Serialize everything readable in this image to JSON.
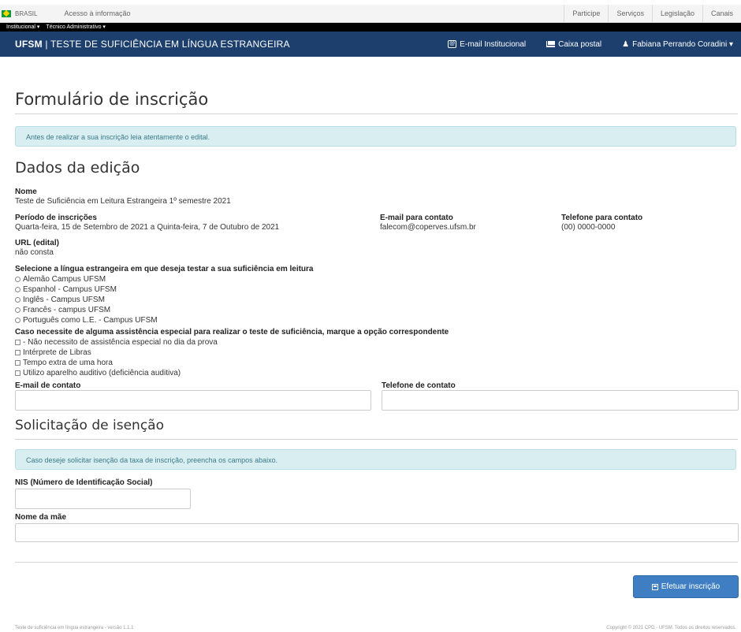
{
  "gov_bar": {
    "brasil": "BRASIL",
    "acesso": "Acesso à informação",
    "links": [
      "Participe",
      "Serviços",
      "Legislação",
      "Canais"
    ]
  },
  "sub_bar": {
    "items": [
      "Institucional ▾",
      "Técnico Administrativo ▾"
    ]
  },
  "navbar": {
    "brand_bold": "UFSM",
    "brand_rest": " | TESTE DE SUFICIÊNCIA EM LÍNGUA ESTRANGEIRA",
    "email_inst": "E-mail Institucional",
    "caixa_postal": "Caixa postal",
    "user": "Fabiana Perrando Coradini ▾"
  },
  "page_title": "Formulário de inscrição",
  "alert_edital": "Antes de realizar a sua inscrição leia atentamente o edital.",
  "dados": {
    "title": "Dados da edição",
    "nome_label": "Nome",
    "nome_value": "Teste de Suficiência em Leitura Estrangeira 1º semestre 2021",
    "periodo_label": "Período de inscrições",
    "periodo_value": "Quarta-feira, 15 de Setembro de 2021 a Quinta-feira, 7 de Outubro de 2021",
    "email_label": "E-mail para contato",
    "email_value": "falecom@coperves.ufsm.br",
    "telefone_label": "Telefone para contato",
    "telefone_value": "(00) 0000-0000",
    "url_label": "URL (edital)",
    "url_value": "não consta"
  },
  "lingua": {
    "label": "Selecione a língua estrangeira em que deseja testar a sua suficiência em leitura",
    "options": [
      "Alemão Campus UFSM",
      "Espanhol - Campus UFSM",
      "Inglês - Campus UFSM",
      "Francês - campus UFSM",
      "Português como L.E. - Campus UFSM"
    ]
  },
  "assistencia": {
    "label": "Caso necessite de alguma assistência especial para realizar o teste de suficiência, marque a opção correspondente",
    "options": [
      "- Não necessito de assistência especial no dia da prova",
      "Intérprete de Libras",
      "Tempo extra de uma hora",
      "Utilizo aparelho auditivo (deficiência auditiva)"
    ]
  },
  "contato": {
    "email_label": "E-mail de contato",
    "telefone_label": "Telefone de contato"
  },
  "isencao": {
    "title": "Solicitação de isenção",
    "alert": "Caso deseje solicitar isenção da taxa de inscrição, preencha os campos abaixo.",
    "nis_label": "NIS (Número de Identificação Social)",
    "mae_label": "Nome da mãe"
  },
  "submit_label": "Efetuar inscrição",
  "footer": {
    "left": "Teste de suficiência em língua estrangeira - versão 1.1.1",
    "right": "Copyright © 2021 CPD - UFSM. Todos os direitos reservados."
  }
}
